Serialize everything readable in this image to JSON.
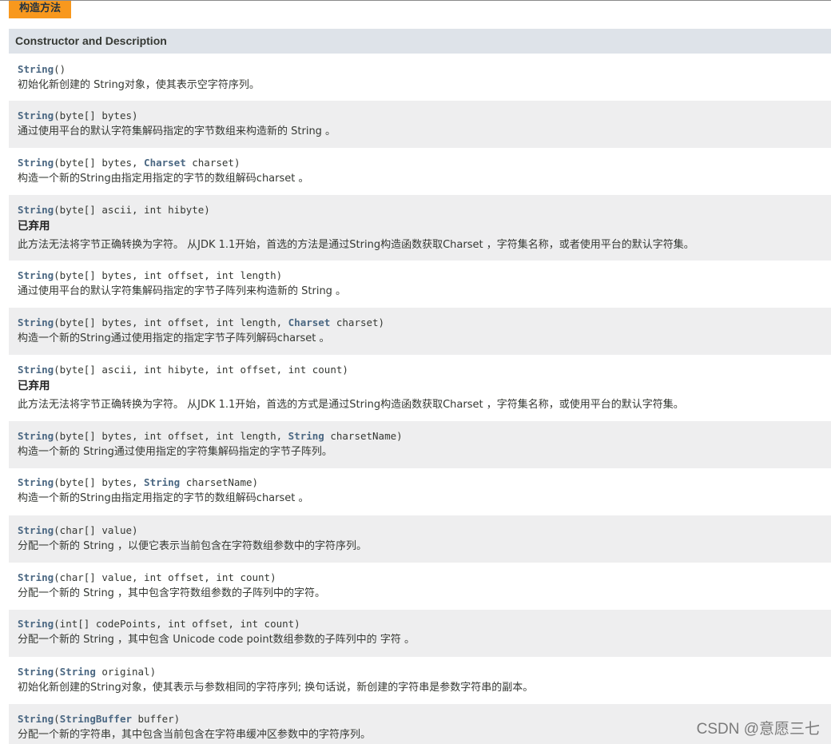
{
  "caption": "构造方法",
  "header": "Constructor and Description",
  "rows": [
    {
      "sig": [
        "String",
        "()"
      ],
      "desc": "初始化新创建的 String对象，使其表示空字符序列。"
    },
    {
      "sig": [
        "String",
        "(byte[] bytes)"
      ],
      "desc": "通过使用平台的默认字符集解码指定的字节数组来构造新的 String 。"
    },
    {
      "sig": [
        "String",
        "(byte[] bytes, ",
        "Charset",
        " charset)"
      ],
      "desc": "构造一个新的String由指定用指定的字节的数组解码charset 。"
    },
    {
      "sig": [
        "String",
        "(byte[] ascii, int hibyte)"
      ],
      "deprecated": "已弃用",
      "desc": "此方法无法将字节正确转换为字符。 从JDK 1.1开始，首选的方法是通过String构造函数获取Charset ，字符集名称，或者使用平台的默认字符集。"
    },
    {
      "sig": [
        "String",
        "(byte[] bytes, int offset, int length)"
      ],
      "desc": "通过使用平台的默认字符集解码指定的字节子阵列来构造新的 String 。"
    },
    {
      "sig": [
        "String",
        "(byte[] bytes, int offset, int length, ",
        "Charset",
        " charset)"
      ],
      "desc": "构造一个新的String通过使用指定的指定字节子阵列解码charset 。"
    },
    {
      "sig": [
        "String",
        "(byte[] ascii, int hibyte, int offset, int count)"
      ],
      "deprecated": "已弃用",
      "desc": "此方法无法将字节正确转换为字符。 从JDK 1.1开始，首选的方式是通过String构造函数获取Charset ，字符集名称，或使用平台的默认字符集。"
    },
    {
      "sig": [
        "String",
        "(byte[] bytes, int offset, int length, ",
        "String",
        " charsetName)"
      ],
      "desc": "构造一个新的 String通过使用指定的字符集解码指定的字节子阵列。"
    },
    {
      "sig": [
        "String",
        "(byte[] bytes, ",
        "String",
        " charsetName)"
      ],
      "desc": "构造一个新的String由指定用指定的字节的数组解码charset 。"
    },
    {
      "sig": [
        "String",
        "(char[] value)"
      ],
      "desc": "分配一个新的 String ，以便它表示当前包含在字符数组参数中的字符序列。"
    },
    {
      "sig": [
        "String",
        "(char[] value, int offset, int count)"
      ],
      "desc": "分配一个新的 String ，其中包含字符数组参数的子阵列中的字符。"
    },
    {
      "sig": [
        "String",
        "(int[] codePoints, int offset, int count)"
      ],
      "desc": "分配一个新的 String ，其中包含 Unicode code point数组参数的子阵列中的 字符 。"
    },
    {
      "sig": [
        "String",
        "(",
        "String",
        " original)"
      ],
      "desc": "初始化新创建的String对象，使其表示与参数相同的字符序列; 换句话说，新创建的字符串是参数字符串的副本。"
    },
    {
      "sig": [
        "String",
        "(",
        "StringBuffer",
        " buffer)"
      ],
      "desc": "分配一个新的字符串，其中包含当前包含在字符串缓冲区参数中的字符序列。"
    }
  ],
  "watermark": "CSDN @意愿三七"
}
